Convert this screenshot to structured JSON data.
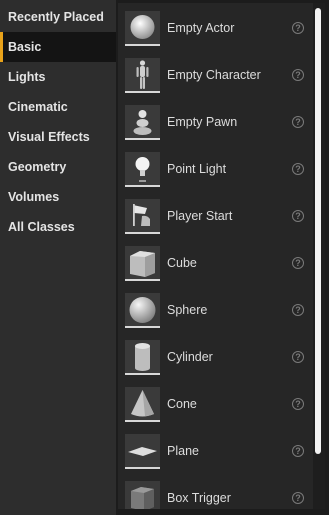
{
  "categories": [
    {
      "label": "Recently Placed",
      "active": false
    },
    {
      "label": "Basic",
      "active": true
    },
    {
      "label": "Lights",
      "active": false
    },
    {
      "label": "Cinematic",
      "active": false
    },
    {
      "label": "Visual Effects",
      "active": false
    },
    {
      "label": "Geometry",
      "active": false
    },
    {
      "label": "Volumes",
      "active": false
    },
    {
      "label": "All Classes",
      "active": false
    }
  ],
  "items": [
    {
      "label": "Empty Actor",
      "icon": "sphere-actor-icon"
    },
    {
      "label": "Empty Character",
      "icon": "mannequin-icon"
    },
    {
      "label": "Empty Pawn",
      "icon": "pawn-icon"
    },
    {
      "label": "Point Light",
      "icon": "lightbulb-icon"
    },
    {
      "label": "Player Start",
      "icon": "flag-icon"
    },
    {
      "label": "Cube",
      "icon": "cube-icon"
    },
    {
      "label": "Sphere",
      "icon": "sphere-icon"
    },
    {
      "label": "Cylinder",
      "icon": "cylinder-icon"
    },
    {
      "label": "Cone",
      "icon": "cone-icon"
    },
    {
      "label": "Plane",
      "icon": "plane-icon"
    },
    {
      "label": "Box Trigger",
      "icon": "box-trigger-icon"
    }
  ],
  "help_glyph": "?",
  "colors": {
    "accent": "#e8a21a",
    "sidebar_bg": "#2d2d2d",
    "panel_bg": "#262626",
    "active_bg": "#141414"
  }
}
